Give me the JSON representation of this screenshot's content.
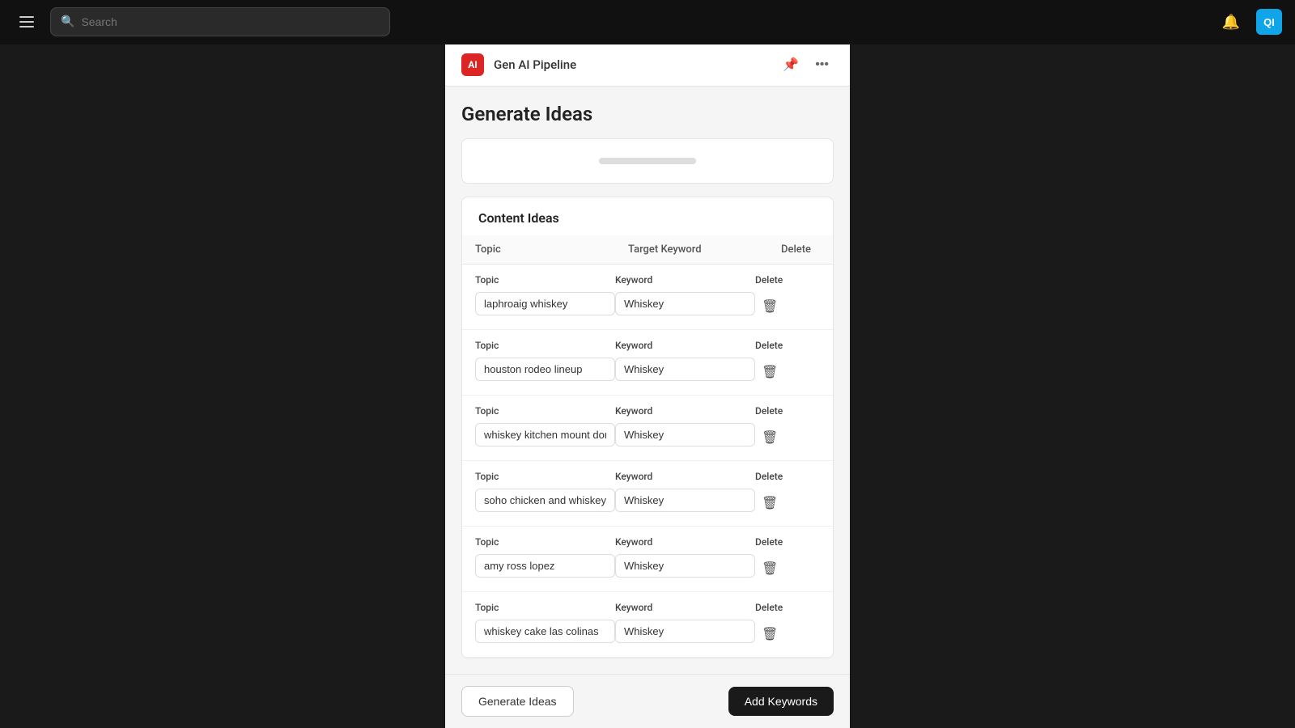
{
  "nav": {
    "menu_icon": "☰",
    "search_placeholder": "Search",
    "bell_icon": "🔔",
    "avatar_label": "QI"
  },
  "sub_header": {
    "logo_text": "AI",
    "title": "Gen AI Pipeline",
    "pin_icon": "📌",
    "more_icon": "•••"
  },
  "page": {
    "title": "Generate Ideas"
  },
  "content_ideas": {
    "section_title": "Content Ideas",
    "table_headers": {
      "topic": "Topic",
      "keyword": "Target Keyword",
      "delete": "Delete"
    },
    "rows": [
      {
        "topic_label": "Topic",
        "topic_value": "laphroaig whiskey",
        "keyword_label": "Keyword",
        "keyword_value": "Whiskey",
        "delete_label": "Delete"
      },
      {
        "topic_label": "Topic",
        "topic_value": "houston rodeo lineup",
        "keyword_label": "Keyword",
        "keyword_value": "Whiskey",
        "delete_label": "Delete"
      },
      {
        "topic_label": "Topic",
        "topic_value": "whiskey kitchen mount dora",
        "keyword_label": "Keyword",
        "keyword_value": "Whiskey",
        "delete_label": "Delete"
      },
      {
        "topic_label": "Topic",
        "topic_value": "soho chicken and whiskey",
        "keyword_label": "Keyword",
        "keyword_value": "Whiskey",
        "delete_label": "Delete"
      },
      {
        "topic_label": "Topic",
        "topic_value": "amy ross lopez",
        "keyword_label": "Keyword",
        "keyword_value": "Whiskey",
        "delete_label": "Delete"
      },
      {
        "topic_label": "Topic",
        "topic_value": "whiskey cake las colinas",
        "keyword_label": "Keyword",
        "keyword_value": "Whiskey",
        "delete_label": "Delete"
      }
    ]
  },
  "actions": {
    "generate_label": "Generate Ideas",
    "add_keywords_label": "Add Keywords"
  }
}
